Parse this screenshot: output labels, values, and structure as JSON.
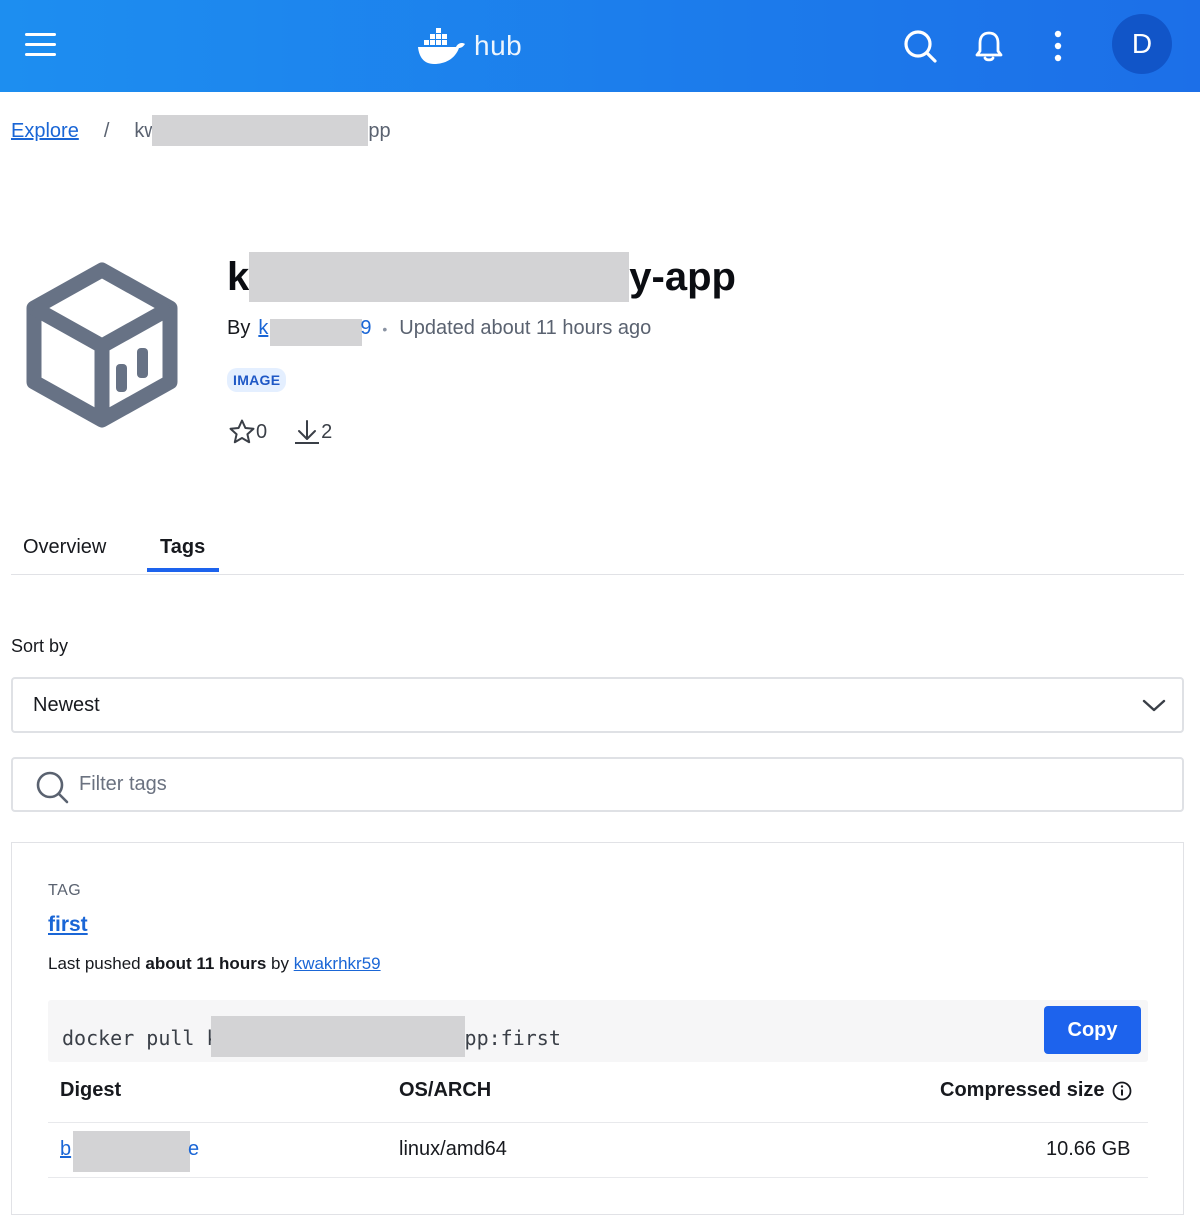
{
  "header": {
    "logo_text": "hub",
    "avatar_initial": "D",
    "accent_color": "#1d63ed"
  },
  "breadcrumb": {
    "root": "Explore",
    "separator": "/",
    "current_start": "kw",
    "current_end": "pp"
  },
  "repo": {
    "title_start": "k",
    "title_end": "y-app",
    "by_label": "By",
    "author_start": "k",
    "author_end": "9",
    "separator": "•",
    "updated": "Updated about 11 hours ago",
    "badge": "IMAGE",
    "stars": "0",
    "pulls": "2"
  },
  "tabs": [
    {
      "label": "Overview",
      "active": false
    },
    {
      "label": "Tags",
      "active": true
    }
  ],
  "sort": {
    "label": "Sort by",
    "selected": "Newest"
  },
  "filter": {
    "placeholder": "Filter tags"
  },
  "tag_card": {
    "tag_label": "TAG",
    "tag_name": "first",
    "pushed_prefix": "Last pushed ",
    "pushed_time": "about 11 hours",
    "pushed_by": " by ",
    "pushed_user": "kwakrhkr59",
    "command_start": "docker pull k",
    "command_end": "pp:first",
    "copy_label": "Copy",
    "columns": {
      "digest": "Digest",
      "os_arch": "OS/ARCH",
      "size": "Compressed size"
    },
    "rows": [
      {
        "digest_start": "b",
        "digest_end": "e",
        "os_arch": "linux/amd64",
        "size": "10.66 GB"
      }
    ]
  }
}
